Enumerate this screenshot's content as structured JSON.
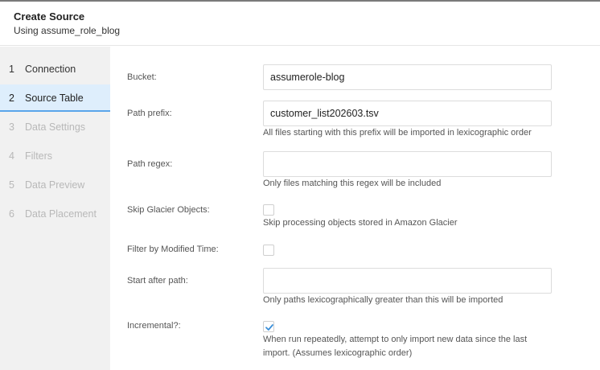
{
  "header": {
    "title": "Create Source",
    "subtitle": "Using assume_role_blog"
  },
  "steps": [
    {
      "num": "1",
      "label": "Connection",
      "state": "done"
    },
    {
      "num": "2",
      "label": "Source Table",
      "state": "active"
    },
    {
      "num": "3",
      "label": "Data Settings",
      "state": "disabled"
    },
    {
      "num": "4",
      "label": "Filters",
      "state": "disabled"
    },
    {
      "num": "5",
      "label": "Data Preview",
      "state": "disabled"
    },
    {
      "num": "6",
      "label": "Data Placement",
      "state": "disabled"
    }
  ],
  "form": {
    "bucket": {
      "label": "Bucket:",
      "value": "assumerole-blog"
    },
    "path_prefix": {
      "label": "Path prefix:",
      "value": "customer_list202603.tsv",
      "help": "All files starting with this prefix will be imported in lexicographic order"
    },
    "path_regex": {
      "label": "Path regex:",
      "value": "",
      "help": "Only files matching this regex will be included"
    },
    "skip_glacier": {
      "label": "Skip Glacier Objects:",
      "checked": false,
      "help": "Skip processing objects stored in Amazon Glacier"
    },
    "filter_modified": {
      "label": "Filter by Modified Time:",
      "checked": false
    },
    "start_after": {
      "label": "Start after path:",
      "value": "",
      "help": "Only paths lexicographically greater than this will be imported"
    },
    "incremental": {
      "label": "Incremental?:",
      "checked": true,
      "help_line1": "When run repeatedly, attempt to only import new data since the last",
      "help_line2": "import. (Assumes lexicographic order)"
    }
  },
  "colors": {
    "active_step_bg": "#deeefc",
    "active_step_border": "#5aa5ea",
    "checkmark": "#3a8fd9"
  },
  "icons": {
    "incremental_checkbox": "check-icon"
  }
}
